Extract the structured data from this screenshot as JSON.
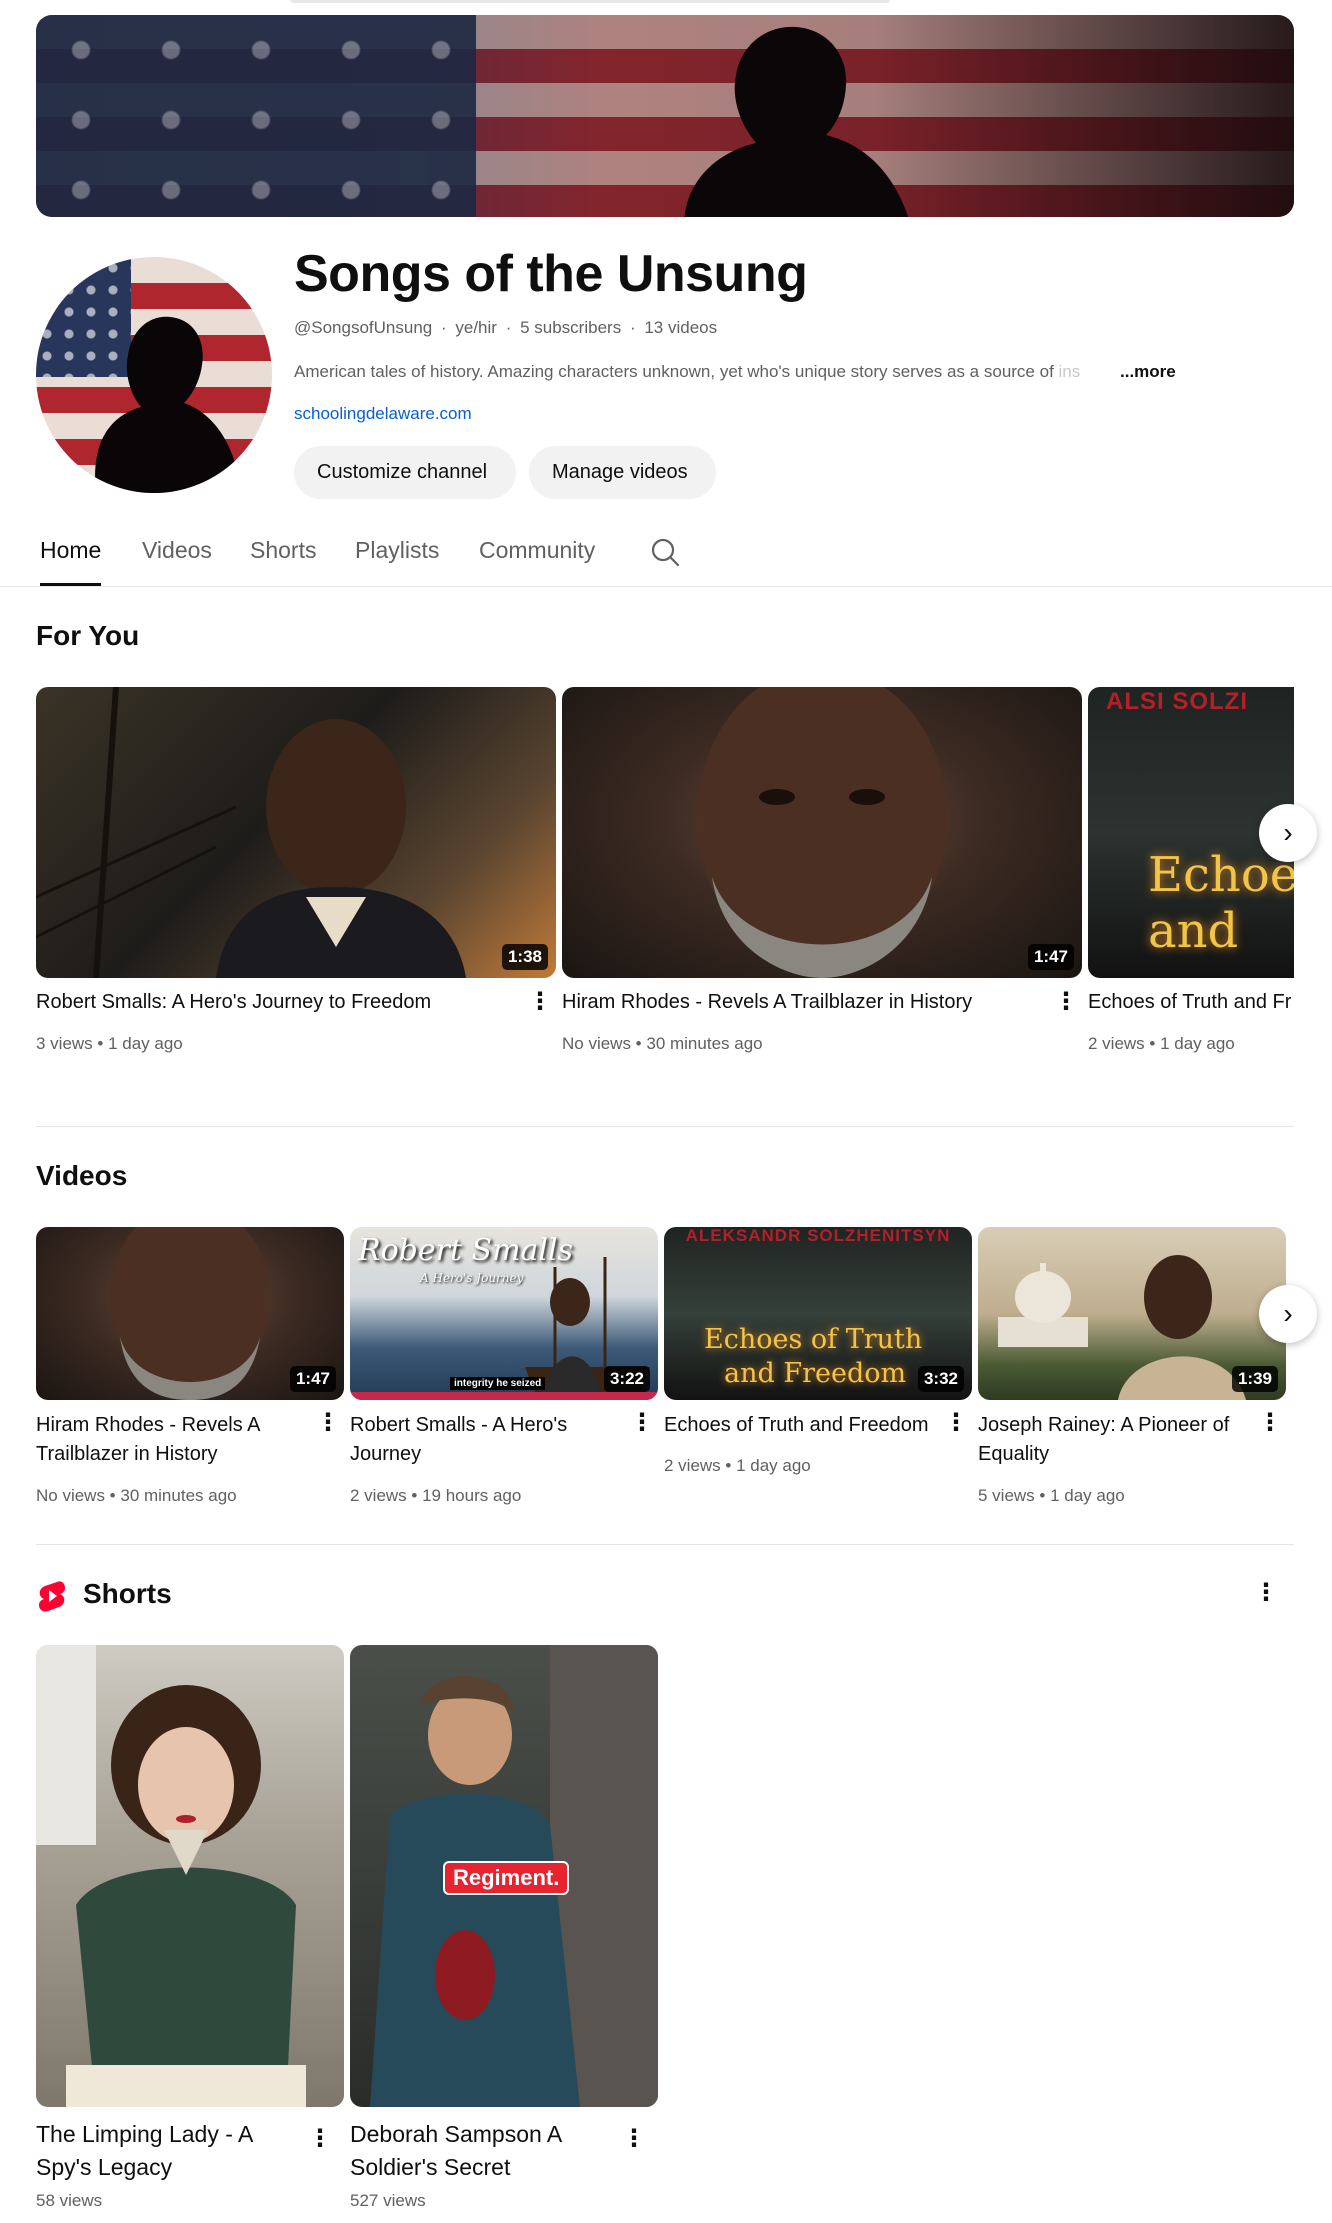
{
  "channel": {
    "name": "Songs of the Unsung",
    "handle": "@SongsofUnsung",
    "pronouns": "ye/hir",
    "subscribers": "5 subscribers",
    "videos_count": "13 videos",
    "description": "American tales of history.  Amazing characters unknown, yet who's unique story serves as a source of ",
    "description_faded": "ins",
    "more_label": "...more",
    "link": "schoolingdelaware.com",
    "customize_label": "Customize channel",
    "manage_label": "Manage videos"
  },
  "tabs": [
    {
      "label": "Home",
      "active": true
    },
    {
      "label": "Videos"
    },
    {
      "label": "Shorts"
    },
    {
      "label": "Playlists"
    },
    {
      "label": "Community"
    }
  ],
  "for_you": {
    "title": "For You",
    "items": [
      {
        "title": "Robert Smalls: A Hero's Journey to Freedom",
        "meta": "3 views • 1 day ago",
        "duration": "1:38"
      },
      {
        "title": "Hiram Rhodes - Revels A Trailblazer in History",
        "meta": "No views • 30 minutes ago",
        "duration": "1:47"
      },
      {
        "title": "Echoes of Truth and Fr",
        "meta": "2 views • 1 day ago",
        "thumb_text": "Echoe and",
        "thumb_top": "ALSI SOLZI"
      }
    ]
  },
  "videos": {
    "title": "Videos",
    "items": [
      {
        "title_line1": "Hiram Rhodes - Revels A",
        "title_line2": "Trailblazer in History",
        "meta": "No views • 30 minutes ago",
        "duration": "1:47"
      },
      {
        "title_line1": "Robert Smalls - A Hero's",
        "title_line2": "Journey",
        "meta": "2 views • 19 hours ago",
        "duration": "3:22",
        "thumb_title": "Robert Smalls",
        "thumb_sub": "A Hero's Journey",
        "thumb_caption": "integrity he seized"
      },
      {
        "title_line1": "Echoes of Truth and Freedom",
        "title_line2": "",
        "meta": "2 views • 1 day ago",
        "duration": "3:32",
        "thumb_top": "ALEKSANDR SOLZHENITSYN",
        "thumb_line1": "Echoes of Truth",
        "thumb_line2": "and Freedom"
      },
      {
        "title_line1": "Joseph Rainey: A Pioneer of",
        "title_line2": "Equality",
        "meta": "5 views • 1 day ago",
        "duration": "1:39"
      }
    ]
  },
  "shorts": {
    "title": "Shorts",
    "items": [
      {
        "title_line1": "The Limping Lady  - A",
        "title_line2": "Spy's Legacy",
        "meta": "58 views"
      },
      {
        "title_line1": "Deborah Sampson  A",
        "title_line2": "Soldier's Secret",
        "meta": "527 views",
        "caption": "Regiment."
      }
    ]
  },
  "icons": {
    "search": "search-icon",
    "next": "chevron-right-icon",
    "more": "more-vert-icon",
    "shorts": "shorts-logo-icon"
  },
  "colors": {
    "link": "#065fd4",
    "shorts_red": "#ff0033",
    "meta_gray": "#606060"
  }
}
